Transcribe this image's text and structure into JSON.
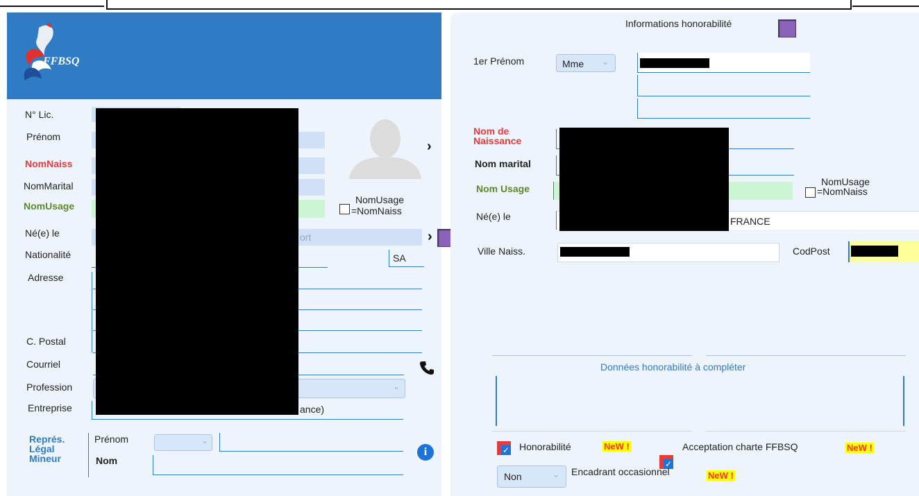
{
  "left": {
    "logo_text": "FFBSQ",
    "labels": {
      "lic": "N° Lic.",
      "prenom": "Prénom",
      "nomnaiss": "NomNaiss",
      "nommarital": "NomMarital",
      "nomusage": "NomUsage",
      "ne_le": "Né(e) le",
      "nationalite": "Nationalité",
      "adresse": "Adresse",
      "cpostal": "C. Postal",
      "courriel": "Courriel",
      "profession": "Profession",
      "entreprise": "Entreprise"
    },
    "nomusage_check_label_1": "NomUsage",
    "nomusage_check_label_2": "=NomNaiss",
    "ne_le_tail": "ort",
    "nationalite_tail": "SA",
    "entreprise_tail": "ance)",
    "repres": {
      "title_1": "Représ.",
      "title_2": "Légal",
      "title_3": "Mineur",
      "prenom_label": "Prénom",
      "nom_label": "Nom"
    }
  },
  "right": {
    "header": "Informations honorabilité",
    "prenom_label": "1er Prénom",
    "civilite": "Mme",
    "nom_naiss_label_1": "Nom de",
    "nom_naiss_label_2": "Naissance",
    "nom_marital_label": "Nom marital",
    "nom_usage_label": "Nom Usage",
    "nomusage_check_label_1": "NomUsage",
    "nomusage_check_label_2": "=NomNaiss",
    "ne_le_label": "Né(e) le",
    "ne_le_tail": "FRANCE",
    "ville_label": "Ville Naiss.",
    "codpost_label": "CodPost",
    "donnees_title": "Données honorabilité à compléter",
    "honorabilite_label": "Honorabilité",
    "charte_label": "Acceptation charte FFBSQ",
    "new_badge": "NeW !",
    "encadrant_value": "Non",
    "encadrant_label": "Encadrant occasionnel"
  },
  "colors": {
    "banner": "#2f7bc4",
    "panel_bg": "#eef4fc",
    "accent_purple": "#8a63b8",
    "label_red": "#e53b3b",
    "label_green": "#5a8a2a",
    "nomusage_field": "#ccf5d4",
    "codpost_field": "#ffff99"
  }
}
